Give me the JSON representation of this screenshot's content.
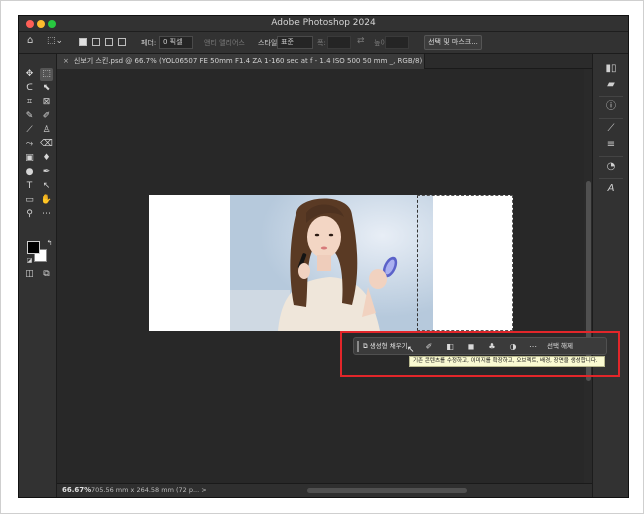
{
  "window": {
    "title": "Adobe Photoshop 2024"
  },
  "options_bar": {
    "home_icon": "home-icon",
    "feather_label": "페더:",
    "feather_value": "0 픽셀",
    "antialias_label": "앤티 앨리어스",
    "style_label": "스타일:",
    "style_value": "표준",
    "width_label": "폭:",
    "height_label": "높이:",
    "select_mask_label": "선택 및 마스크..."
  },
  "document_tab": {
    "title": "신보기 스킨.psd @ 66.7% (YOL06507  FE 50mm F1.4 ZA  1-160 sec at f - 1.4  ISO 500 50 mm _, RGB/8) *"
  },
  "tools": [
    "move-tool-icon",
    "marquee-tool-icon",
    "lasso-tool-icon",
    "object-select-tool-icon",
    "crop-tool-icon",
    "frame-tool-icon",
    "eyedropper-tool-icon",
    "healing-brush-icon",
    "brush-tool-icon",
    "clone-stamp-icon",
    "history-brush-icon",
    "eraser-tool-icon",
    "gradient-tool-icon",
    "blur-tool-icon",
    "dodge-tool-icon",
    "pen-tool-icon",
    "type-tool-icon",
    "path-select-icon",
    "rectangle-tool-icon",
    "hand-tool-icon",
    "zoom-tool-icon",
    "more-tools-icon"
  ],
  "contextual_taskbar": {
    "generative_fill_label": "생성형 채우기",
    "deselect_label": "선택 해제",
    "tooltip": "기존 콘텐츠를 수정하고, 이미지를 확장하고, 오브젝트, 배경, 장면을 생성합니다."
  },
  "status_bar": {
    "zoom": "66.67%",
    "doc_size": "705.56 mm x 264.58 mm (72 p...  >"
  },
  "colors": {
    "highlight": "#e2262a",
    "tooltip_bg": "#fafad2",
    "foreground": "#000000",
    "background": "#ffffff"
  }
}
